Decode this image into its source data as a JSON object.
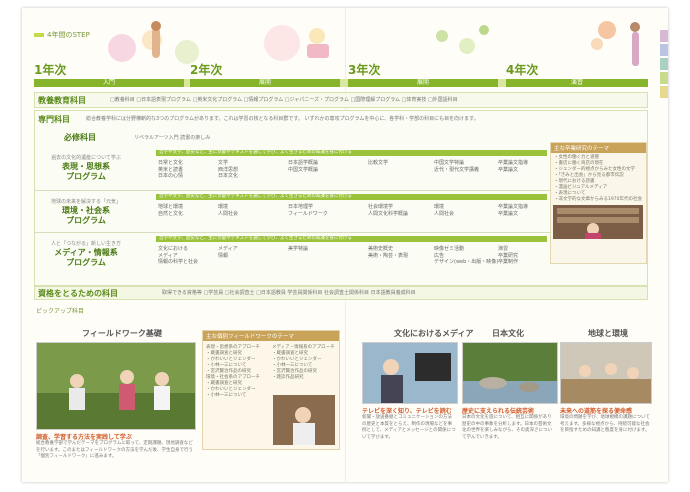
{
  "header": {
    "step_label": "4年間のSTEP"
  },
  "years": [
    "1年次",
    "2年次",
    "3年次",
    "4年次"
  ],
  "stages": [
    "入門",
    "展開",
    "展開",
    "演習"
  ],
  "common": {
    "label": "教養教育科目",
    "items": "□教養科目 □日本語表現プログラム □英米文化プログラム □情報プログラム □ジャパニーズ・プログラム □国際理解プログラム □体育実技 □外国語科目"
  },
  "major": {
    "label": "専門科目",
    "desc": "総合教養学科には分野横断的な3つのプログラムがあります。これは学習の核となる科目群です。 いずれかの専攻プログラムを中心に、各学科・学部の科目にも目を向けます。"
  },
  "required": {
    "label": "必修科目",
    "items": "リベラルアーツ入門 読書の楽しみ"
  },
  "programs": [
    {
      "intro": "過去の文化的遺産について学ぶ",
      "name_line1": "表現・思想系",
      "name_line2": "プログラム",
      "ribbon": "哲学や文学、歴史など、主に文献やテキストを通して学び、よく生きるための知識を身に付ける",
      "cols": [
        "日常と文化\n英米と読書\n日本の心情",
        "文学\n西洋思想\n日本文化",
        "日本語学概論\n中国文学概論",
        "比較文学",
        "中国文学特論\n近代・現代文学講義",
        "卒業論文指導\n卒業論文"
      ]
    },
    {
      "intro": "地球の未来を解決する「元気」",
      "name_line1": "環境・社会系",
      "name_line2": "プログラム",
      "ribbon": "哲学や文学、歴史など、主に文献やテキストを通して学び、よく生きるための知識を身に付ける",
      "cols": [
        "地球と環境\n自然と文化",
        "環境\n人間社会",
        "日本地理学\nフィールドワーク",
        "社会環境学\n人間文化科学概論",
        "環境\n人間社会",
        "卒業論文指導\n卒業論文"
      ]
    },
    {
      "intro": "人と「つながる」新しい生き方",
      "name_line1": "メディア・情報系",
      "name_line2": "プログラム",
      "ribbon": "哲学や文学、歴史など、主に文献やテキストを通して学び、よく生きるための知識を身に付ける",
      "cols": [
        "文化における\nメディア\n情報の科学と社会",
        "メディア\n情報",
        "美学特論",
        "美術史概史\n美術・陶芸・表現",
        "映像ゼミ活動\n広告\nデザイン(web・出版・映像)",
        "演習\n卒業研究\n卒業制作"
      ]
    }
  ],
  "theme": {
    "title": "主な卒業研究のテーマ",
    "items": "・女性の働く力と道徳\n・書店に働く商店の現在\n・ジェンダー的視点からみた女性の文学\n・「きみと出会」から見る都市伝説\n・現代における読書\n・漫画ビジュアルメディア\n・表現について\n・非文学的な文章からみる1970年代の社会"
  },
  "qualify": {
    "label": "資格をとるための科目",
    "items": "取得できる資格等 □学芸員 □社会調査士 □日本語教員 学芸員関係科目 社会調査士関係科目 日本語教員養成科目"
  },
  "pickup": {
    "label": "ピックアップ科目"
  },
  "fieldwork": {
    "title": "フィールドワーク基礎",
    "caption": "調査、学習する方法を実践して学ぶ",
    "body": "総合教養学部で学んだテーマをプログラムに取って、定期課題。現地調査などを行います。このまたはフィールドワークの方法を学んだ後、学生自身で行う「個別フィールドワーク」に進みます。"
  },
  "fwtheme": {
    "title": "主な個別フィールドワークのテーマ",
    "left": "表現・思想系のアプローチ\n・蔵書調査と研究\n・かわいいとジェンダー\n・小林一三について\n・宮沢賢治作品の研究\n環境・社会系のアプローチ\n・蔵書調査と研究\n・かわいいとジェンダー\n・小林一三について",
    "right": "メディア・情報系のアプローチ\n・蔵書調査と研究\n・かわいいとジェンダー\n・小林一三について\n・宮沢賢治作品の研究\n・雑誌作品研究"
  },
  "media": {
    "title": "文化におけるメディア",
    "caption": "テレビを深く知り、テレビを読む",
    "body": "新聞・放送番組とコミュニケーションの方法の歴史と本質をとらえ、制作の現場などを事例として、メディアとメッセージとの関係について学びます。"
  },
  "japan": {
    "title": "日本文化",
    "caption": "歴史に支えられる伝統芸術",
    "body": "日本の文化を旅について、相互に関係があり歴史の中の事象を分析します。日本の芸術文化の世界を楽しみながら、その奥深さについて学んでいきます。"
  },
  "earth": {
    "title": "地球と環境",
    "caption": "未来への道筋を探る便命感",
    "body": "環境の問題を学び、地球規模の課題について考えます。多様な視点から、持続可能な社会を目指すための知識と態度を身に付けます。"
  }
}
